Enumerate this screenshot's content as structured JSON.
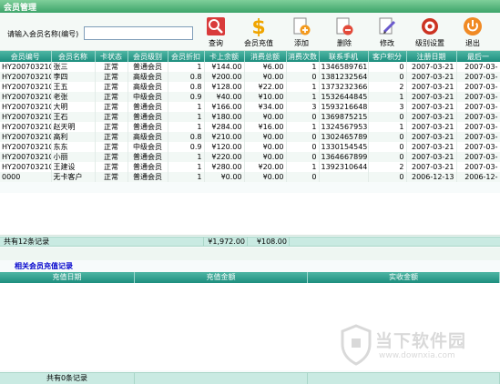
{
  "window": {
    "title": "会员管理"
  },
  "search": {
    "label": "请输入会员名称(编号)",
    "value": "",
    "placeholder": ""
  },
  "toolbar": {
    "query": "查询",
    "recharge": "会员充值",
    "add": "添加",
    "delete": "删除",
    "edit": "修改",
    "level_settings": "级别设置",
    "exit": "退出"
  },
  "members": {
    "columns": [
      "会员编号",
      "会员名称",
      "卡状态",
      "会员级别",
      "会员折扣",
      "卡上余额",
      "消费总额",
      "消费次数",
      "联系手机",
      "客户积分",
      "注册日期",
      "最后一"
    ],
    "rows": [
      [
        "HY20070321011",
        "张三",
        "正常",
        "普通会员",
        "1",
        "¥144.00",
        "¥6.00",
        "1",
        "13465897611",
        "0",
        "2007-03-21",
        "2007-03-"
      ],
      [
        "HY20070321010",
        "李四",
        "正常",
        "高级会员",
        "0.8",
        "¥200.00",
        "¥0.00",
        "0",
        "13812325649",
        "0",
        "2007-03-21",
        "2007-03-"
      ],
      [
        "HY20070321009",
        "王五",
        "正常",
        "高级会员",
        "0.8",
        "¥128.00",
        "¥22.00",
        "1",
        "13732323660",
        "2",
        "2007-03-21",
        "2007-03-"
      ],
      [
        "HY20070321008",
        "老张",
        "正常",
        "中级会员",
        "0.9",
        "¥40.00",
        "¥10.00",
        "1",
        "15326448456",
        "1",
        "2007-03-21",
        "2007-03-"
      ],
      [
        "HY20070321007",
        "大明",
        "正常",
        "普通会员",
        "1",
        "¥166.00",
        "¥34.00",
        "3",
        "15932166489",
        "3",
        "2007-03-21",
        "2007-03-"
      ],
      [
        "HY20070321006",
        "王石",
        "正常",
        "普通会员",
        "1",
        "¥180.00",
        "¥0.00",
        "0",
        "13698752156",
        "0",
        "2007-03-21",
        "2007-03-"
      ],
      [
        "HY20070321005",
        "赵天明",
        "正常",
        "普通会员",
        "1",
        "¥284.00",
        "¥16.00",
        "1",
        "13245679536",
        "1",
        "2007-03-21",
        "2007-03-"
      ],
      [
        "HY20070321004",
        "高利",
        "正常",
        "高级会员",
        "0.8",
        "¥210.00",
        "¥0.00",
        "0",
        "13024657896",
        "0",
        "2007-03-21",
        "2007-03-"
      ],
      [
        "HY20070321003",
        "东东",
        "正常",
        "中级会员",
        "0.9",
        "¥120.00",
        "¥0.00",
        "0",
        "13301545450",
        "0",
        "2007-03-21",
        "2007-03-"
      ],
      [
        "HY20070321002",
        "小丽",
        "正常",
        "普通会员",
        "1",
        "¥220.00",
        "¥0.00",
        "0",
        "13646678995",
        "0",
        "2007-03-21",
        "2007-03-"
      ],
      [
        "HY20070321001",
        "王建设",
        "正常",
        "普通会员",
        "1",
        "¥280.00",
        "¥20.00",
        "1",
        "13923106445",
        "2",
        "2007-03-21",
        "2007-03-"
      ],
      [
        "0000",
        "无卡客户",
        "正常",
        "普通会员",
        "1",
        "¥0.00",
        "¥0.00",
        "0",
        "",
        "0",
        "2006-12-13",
        "2006-12-"
      ]
    ],
    "footer": {
      "count": "共有12条记录",
      "balance_total": "¥1,972.00",
      "consume_total": "¥108.00"
    }
  },
  "recharge": {
    "title": "相关会员充值记录",
    "columns": [
      "充值日期",
      "充值金额",
      "实收金额"
    ],
    "footer": {
      "count": "共有0条记录"
    }
  },
  "watermark": {
    "text": "当下软件园",
    "url": "www.downxia.com"
  },
  "colors": {
    "header": "#1d8e7e",
    "titlebar": "#3da46a",
    "link": "#0000cc"
  }
}
